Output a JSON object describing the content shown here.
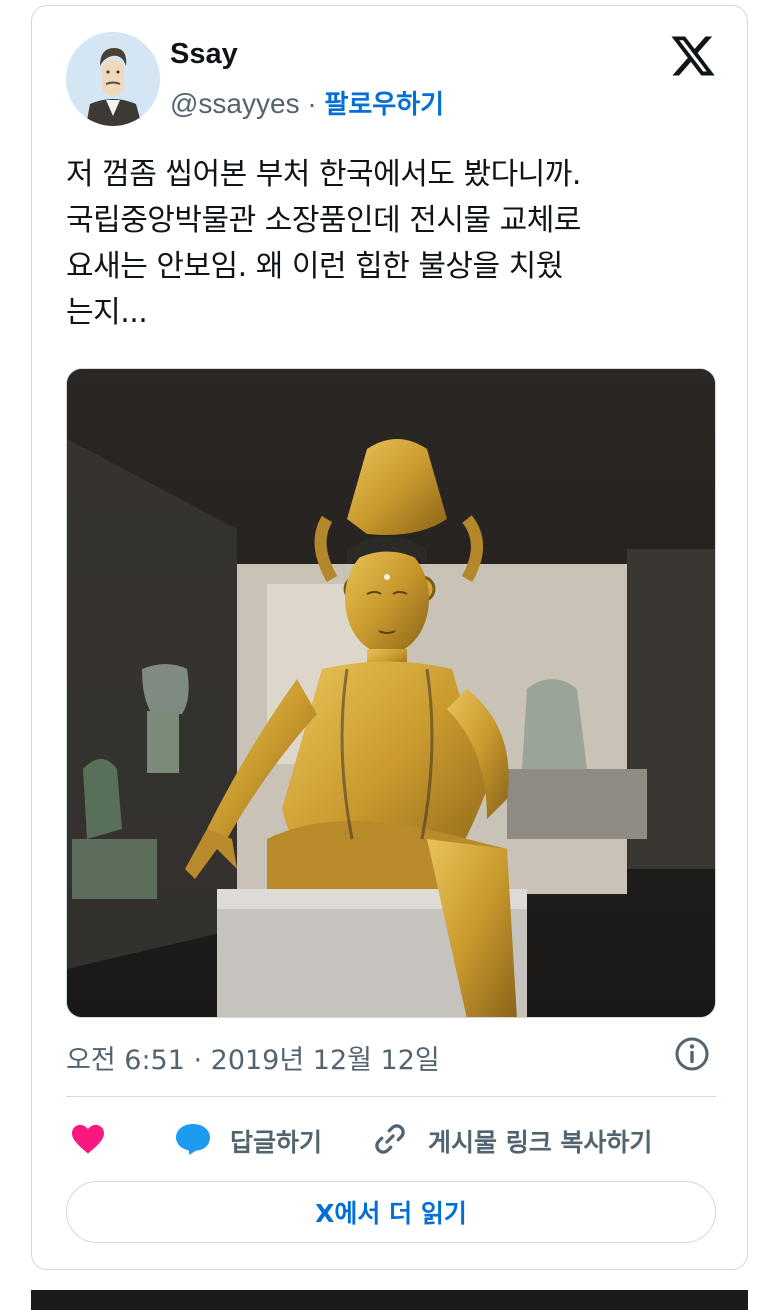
{
  "author": {
    "name": "Ssay",
    "handle": "@ssayyes",
    "separator": " · ",
    "follow_label": "팔로우하기"
  },
  "tweet": {
    "text": "저 껌좀 씹어본 부처 한국에서도 봤다니까.\n국립중앙박물관 소장품인데 전시물 교체로\n요새는 안보임. 왜 이런 힙한 불상을 치웠\n는지...",
    "timestamp": "오전 6:51 · 2019년 12월 12일"
  },
  "actions": {
    "like_icon": "heart-icon",
    "reply_label": "답글하기",
    "copy_link_label": "게시물 링크 복사하기"
  },
  "read_more_label": "X에서 더 읽기",
  "colors": {
    "accent": "#006fd6",
    "like": "#f91880",
    "reply_icon": "#1d9bf0",
    "muted": "#536471",
    "border": "#cfd9de"
  }
}
